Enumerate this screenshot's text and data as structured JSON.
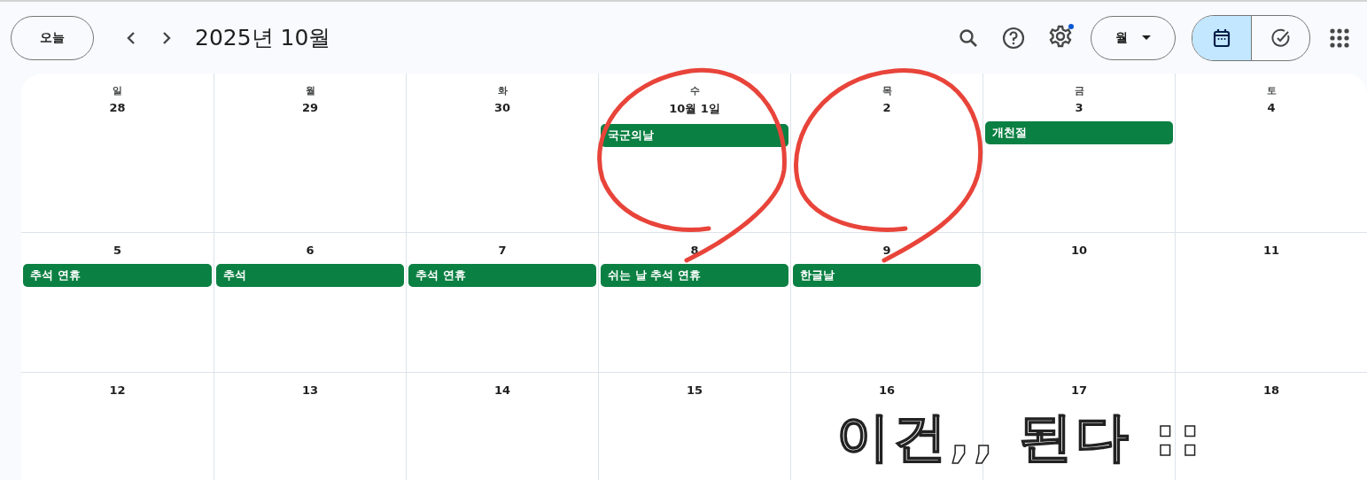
{
  "toolbar": {
    "today_button": "오늘",
    "title": "2025년 10월",
    "settings_notification": true,
    "view_select": "월",
    "mode_toggle": [
      {
        "kind": "calendar",
        "selected": true
      },
      {
        "kind": "tasks",
        "selected": false
      }
    ]
  },
  "weekdays": [
    "일",
    "월",
    "화",
    "수",
    "목",
    "금",
    "토"
  ],
  "weeks": [
    [
      {
        "date": "28"
      },
      {
        "date": "29"
      },
      {
        "date": "30"
      },
      {
        "date": "10월 1일",
        "events": [
          "국군의날"
        ]
      },
      {
        "date": "2"
      },
      {
        "date": "3",
        "events": [
          "개천절"
        ]
      },
      {
        "date": "4"
      }
    ],
    [
      {
        "date": "5",
        "events": [
          "추석 연휴"
        ]
      },
      {
        "date": "6",
        "events": [
          "추석"
        ]
      },
      {
        "date": "7",
        "events": [
          "추석 연휴"
        ]
      },
      {
        "date": "8",
        "events": [
          "쉬는 날 추석 연휴"
        ]
      },
      {
        "date": "9",
        "events": [
          "한글날"
        ]
      },
      {
        "date": "10"
      },
      {
        "date": "11"
      }
    ],
    [
      {
        "date": "12"
      },
      {
        "date": "13"
      },
      {
        "date": "14"
      },
      {
        "date": "15"
      },
      {
        "date": "16"
      },
      {
        "date": "17"
      },
      {
        "date": "18"
      }
    ]
  ],
  "overlay_text": "이건,, 된다 ::"
}
